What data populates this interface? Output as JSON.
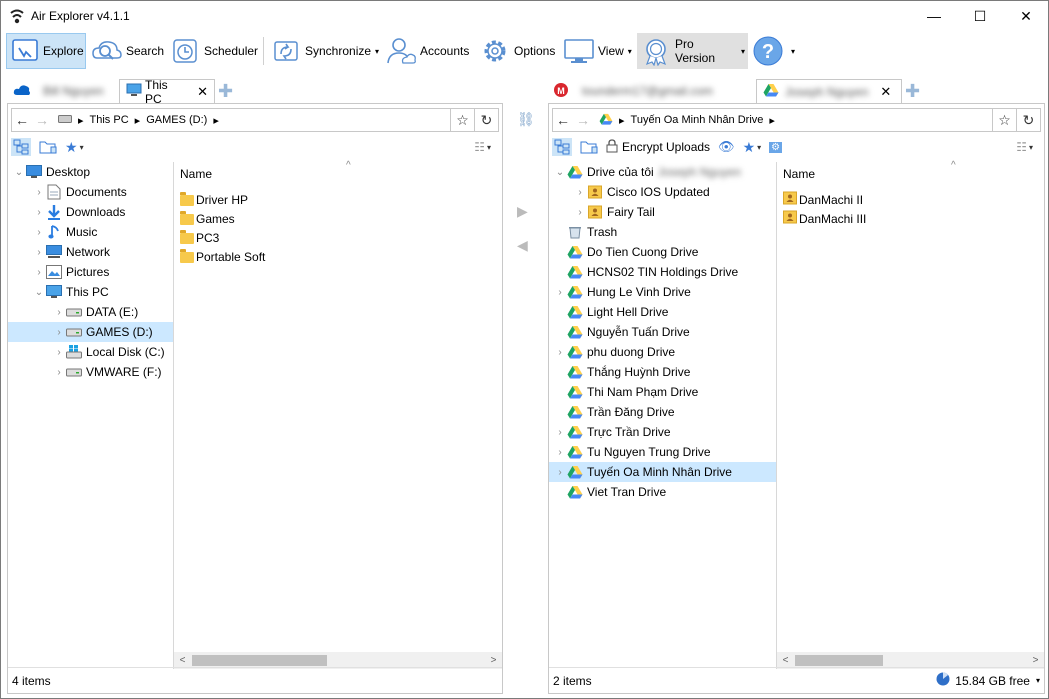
{
  "window": {
    "title": "Air Explorer v4.1.1",
    "minimize": "—",
    "maximize": "☐",
    "close": "✕"
  },
  "toolbar": {
    "explore": "Explore",
    "search": "Search",
    "scheduler": "Scheduler",
    "synchronize": "Synchronize",
    "accounts": "Accounts",
    "options": "Options",
    "view": "View",
    "pro": "Pro Version",
    "caret": "▾"
  },
  "left": {
    "tabs": [
      {
        "label": "Bill Nguyen",
        "blurred": true
      },
      {
        "label": "This PC",
        "blurred": false,
        "close": "✕"
      }
    ],
    "breadcrumb": [
      "This PC",
      "GAMES (D:)"
    ],
    "tree": [
      {
        "label": "Desktop",
        "chev": "⌄",
        "icon": "desktop-icon",
        "indent": 0
      },
      {
        "label": "Documents",
        "chev": "›",
        "icon": "documents-icon",
        "indent": 1
      },
      {
        "label": "Downloads",
        "chev": "›",
        "icon": "downloads-icon",
        "indent": 1
      },
      {
        "label": "Music",
        "chev": "›",
        "icon": "music-icon",
        "indent": 1
      },
      {
        "label": "Network",
        "chev": "›",
        "icon": "network-icon",
        "indent": 1
      },
      {
        "label": "Pictures",
        "chev": "›",
        "icon": "pictures-icon",
        "indent": 1
      },
      {
        "label": "This PC",
        "chev": "⌄",
        "icon": "this-pc-icon",
        "indent": 1
      },
      {
        "label": "DATA (E:)",
        "chev": "›",
        "icon": "drive-icon",
        "indent": 2
      },
      {
        "label": "GAMES (D:)",
        "chev": "›",
        "icon": "drive-icon",
        "indent": 2,
        "selected": true
      },
      {
        "label": "Local Disk (C:)",
        "chev": "›",
        "icon": "windows-drive-icon",
        "indent": 2
      },
      {
        "label": "VMWARE (F:)",
        "chev": "›",
        "icon": "drive-icon",
        "indent": 2
      }
    ],
    "column": "Name",
    "files": [
      "Driver HP",
      "Games",
      "PC3",
      "Portable Soft"
    ],
    "status": "4 items"
  },
  "right": {
    "tabs": [
      {
        "label": "tounderm17@gmail.com",
        "blurred": true
      },
      {
        "label": "Joseph Nguyen",
        "blurred": true,
        "close": "✕"
      }
    ],
    "breadcrumb": [
      "Tuyến Oa Minh Nhân Drive"
    ],
    "encrypt": "Encrypt Uploads",
    "tree": [
      {
        "label": "Drive của tôi",
        "chev": "⌄",
        "icon": "google-drive-icon",
        "indent": 0,
        "suffix": "Joseph Nguyen"
      },
      {
        "label": "Cisco IOS Updated",
        "chev": "›",
        "icon": "shared-folder-icon",
        "indent": 1
      },
      {
        "label": "Fairy Tail",
        "chev": "›",
        "icon": "shared-folder-icon",
        "indent": 1
      },
      {
        "label": "Trash",
        "chev": "",
        "icon": "trash-icon",
        "indent": 0
      },
      {
        "label": "Do Tien Cuong Drive",
        "chev": "",
        "icon": "google-drive-icon",
        "indent": 0
      },
      {
        "label": "HCNS02 TIN Holdings Drive",
        "chev": "",
        "icon": "google-drive-icon",
        "indent": 0
      },
      {
        "label": "Hung Le Vinh Drive",
        "chev": "›",
        "icon": "google-drive-icon",
        "indent": 0
      },
      {
        "label": "Light Hell Drive",
        "chev": "",
        "icon": "google-drive-icon",
        "indent": 0
      },
      {
        "label": "Nguyễn Tuấn Drive",
        "chev": "",
        "icon": "google-drive-icon",
        "indent": 0
      },
      {
        "label": "phu duong Drive",
        "chev": "›",
        "icon": "google-drive-icon",
        "indent": 0
      },
      {
        "label": "Thắng Huỳnh Drive",
        "chev": "",
        "icon": "google-drive-icon",
        "indent": 0
      },
      {
        "label": "Thi Nam Phạm Drive",
        "chev": "",
        "icon": "google-drive-icon",
        "indent": 0
      },
      {
        "label": "Trần Đăng Drive",
        "chev": "",
        "icon": "google-drive-icon",
        "indent": 0
      },
      {
        "label": "Trực Trần Drive",
        "chev": "›",
        "icon": "google-drive-icon",
        "indent": 0
      },
      {
        "label": "Tu Nguyen Trung Drive",
        "chev": "›",
        "icon": "google-drive-icon",
        "indent": 0
      },
      {
        "label": "Tuyến Oa Minh Nhân Drive",
        "chev": "›",
        "icon": "google-drive-icon",
        "indent": 0,
        "selected": true
      },
      {
        "label": "Viet Tran Drive",
        "chev": "",
        "icon": "google-drive-icon",
        "indent": 0
      }
    ],
    "column": "Name",
    "files": [
      "DanMachi II",
      "DanMachi III"
    ],
    "status": "2 items",
    "free": "15.84 GB free"
  },
  "colors": {
    "accent": "#0078d7",
    "selection": "#cce8ff",
    "folder": "#f7c94b",
    "gdrive_green": "#1fa463",
    "gdrive_yellow": "#ffd04b",
    "gdrive_blue": "#4688f4"
  }
}
